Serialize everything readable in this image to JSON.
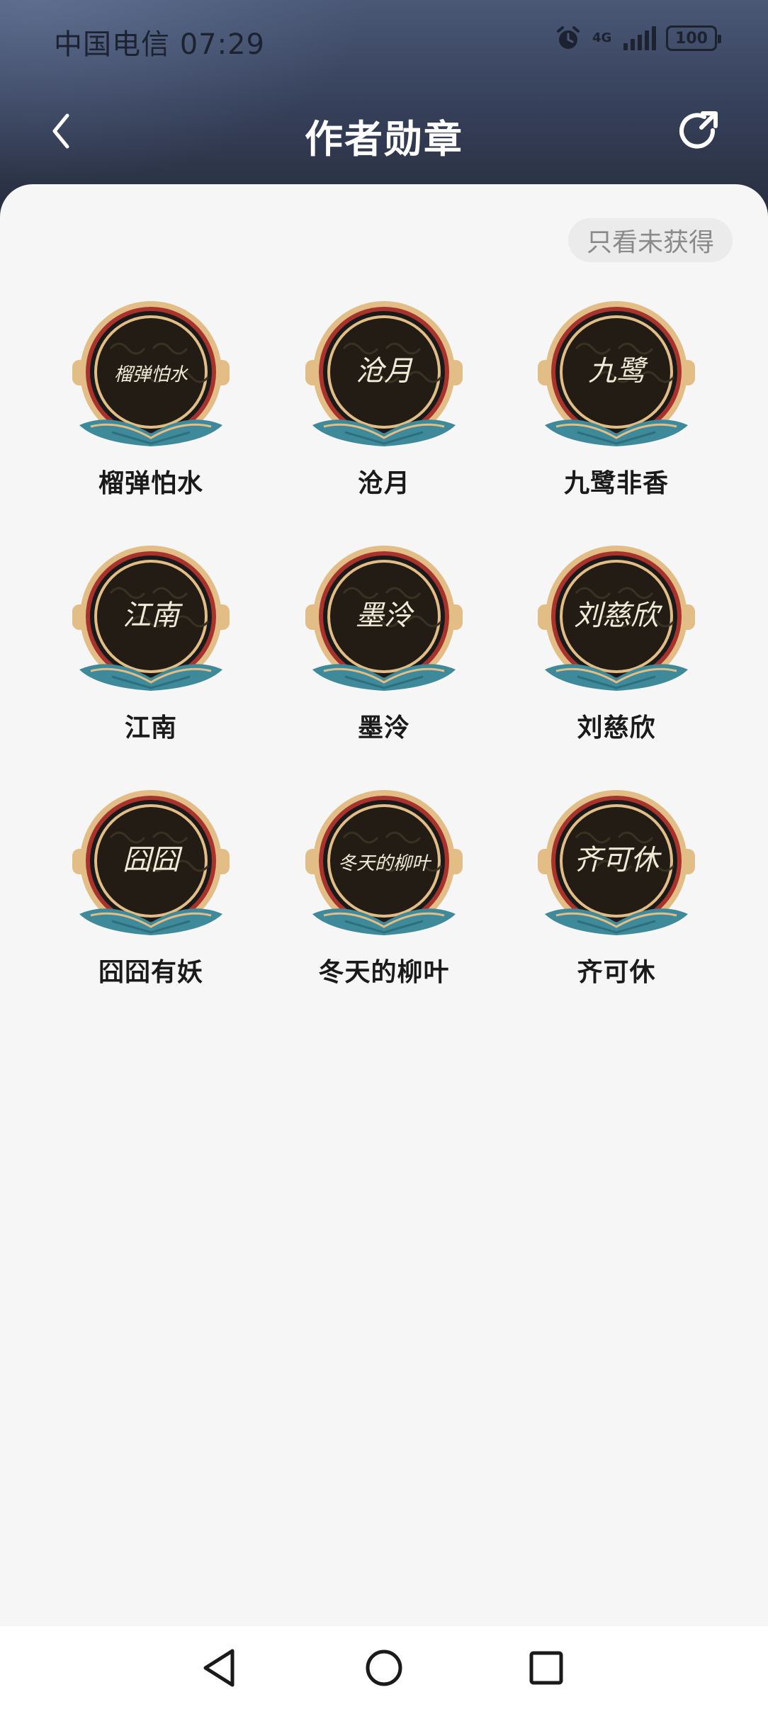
{
  "status_bar": {
    "carrier_time": "中国电信 07:29",
    "network": "4G",
    "battery": "100"
  },
  "header": {
    "title": "作者勋章"
  },
  "filter": {
    "label": "只看未获得"
  },
  "badges": [
    {
      "name": "榴弹怕水",
      "signature": "榴弹怕水"
    },
    {
      "name": "沧月",
      "signature": "沧月"
    },
    {
      "name": "九鹭非香",
      "signature": "九鹭"
    },
    {
      "name": "江南",
      "signature": "江南"
    },
    {
      "name": "墨泠",
      "signature": "墨泠"
    },
    {
      "name": "刘慈欣",
      "signature": "刘慈欣"
    },
    {
      "name": "囧囧有妖",
      "signature": "囧囧"
    },
    {
      "name": "冬天的柳叶",
      "signature": "冬天的柳叶"
    },
    {
      "name": "齐可休",
      "signature": "齐可休"
    }
  ],
  "colors": {
    "header_top": "#4a5876",
    "header_bottom": "#252b3a",
    "medal_gold": "#e2bd86",
    "medal_red": "#a8322c",
    "medal_center": "#221c14",
    "medal_teal": "#3f8a9a"
  }
}
